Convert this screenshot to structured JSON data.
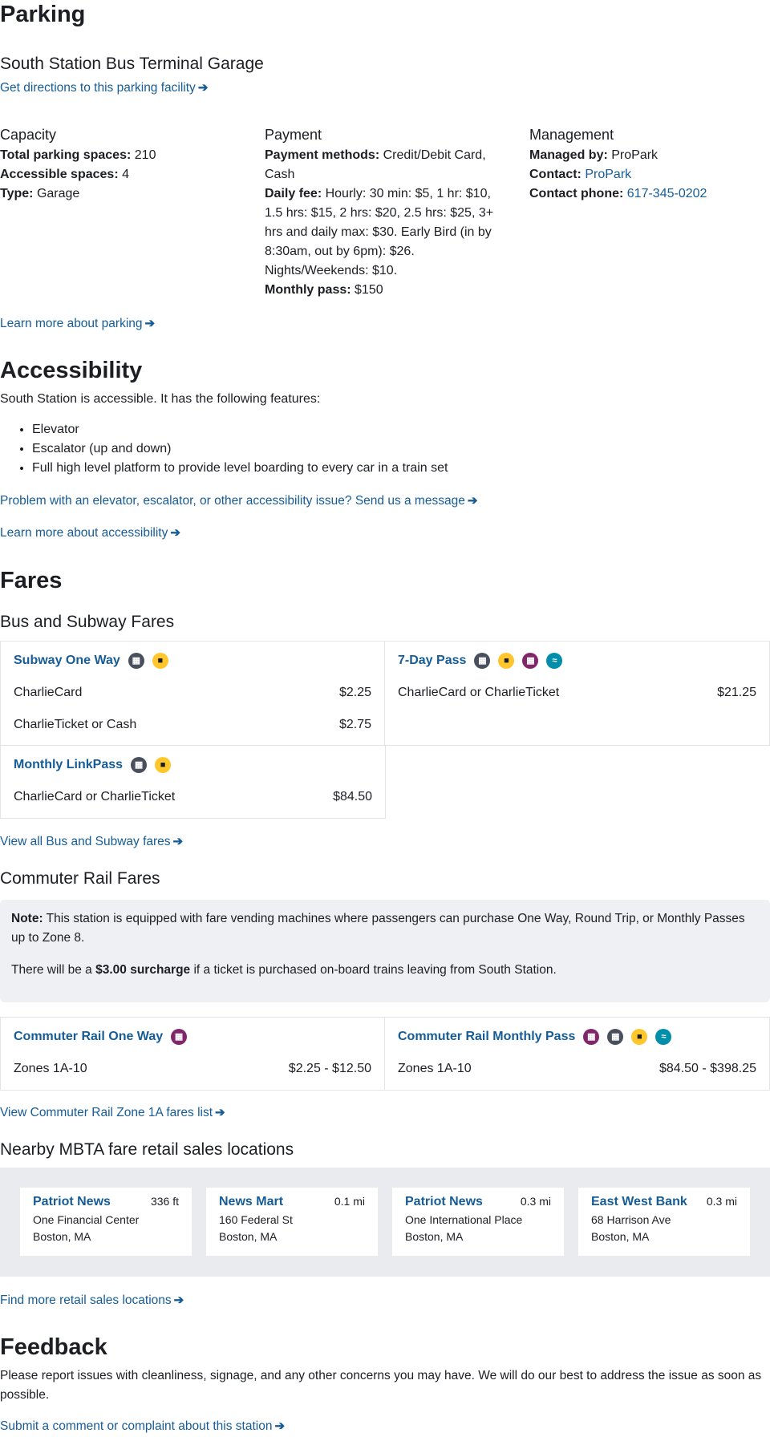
{
  "parking": {
    "title": "Parking",
    "garage_name": "South Station Bus Terminal Garage",
    "directions_link": "Get directions to this parking facility",
    "capacity": {
      "title": "Capacity",
      "total_label": "Total parking spaces:",
      "total_value": "210",
      "accessible_label": "Accessible spaces:",
      "accessible_value": "4",
      "type_label": "Type:",
      "type_value": "Garage"
    },
    "payment": {
      "title": "Payment",
      "methods_label": "Payment methods:",
      "methods_value": "Credit/Debit Card, Cash",
      "fee_label": "Daily fee:",
      "fee_value": "Hourly: 30 min: $5, 1 hr: $10, 1.5 hrs: $15, 2 hrs: $20, 2.5 hrs: $25, 3+ hrs and daily max: $30. Early Bird (in by 8:30am, out by 6pm): $26. Nights/Weekends: $10.",
      "monthly_label": "Monthly pass:",
      "monthly_value": "$150"
    },
    "management": {
      "title": "Management",
      "managed_label": "Managed by:",
      "managed_value": "ProPark",
      "contact_label": "Contact:",
      "contact_value": "ProPark",
      "phone_label": "Contact phone:",
      "phone_value": "617-345-0202"
    },
    "learn_more": "Learn more about parking"
  },
  "accessibility": {
    "title": "Accessibility",
    "intro": "South Station is accessible. It has the following features:",
    "features": [
      "Elevator",
      "Escalator (up and down)",
      "Full high level platform to provide level boarding to every car in a train set"
    ],
    "problem_link": "Problem with an elevator, escalator, or other accessibility issue? Send us a message",
    "learn_more": "Learn more about accessibility"
  },
  "fares": {
    "title": "Fares",
    "bus_subway_title": "Bus and Subway Fares",
    "cards": [
      {
        "name": "Subway One Way",
        "rows": [
          {
            "label": "CharlieCard",
            "price": "$2.25"
          },
          {
            "label": "CharlieTicket or Cash",
            "price": "$2.75"
          }
        ]
      },
      {
        "name": "7-Day Pass",
        "rows": [
          {
            "label": "CharlieCard or CharlieTicket",
            "price": "$21.25"
          }
        ]
      },
      {
        "name": "Monthly LinkPass",
        "rows": [
          {
            "label": "CharlieCard or CharlieTicket",
            "price": "$84.50"
          }
        ]
      }
    ],
    "view_all_bus": "View all Bus and Subway fares",
    "commuter_title": "Commuter Rail Fares",
    "note_label": "Note:",
    "note_text": "This station is equipped with fare vending machines where passengers can purchase One Way, Round Trip, or Monthly Passes up to Zone 8.",
    "surcharge_pre": "There will be a",
    "surcharge_bold": "$3.00 surcharge",
    "surcharge_post": "if a ticket is purchased on-board trains leaving from South Station.",
    "cr_cards": [
      {
        "name": "Commuter Rail One Way",
        "zone": "Zones 1A-10",
        "price": "$2.25 - $12.50"
      },
      {
        "name": "Commuter Rail Monthly Pass",
        "zone": "Zones 1A-10",
        "price": "$84.50 - $398.25"
      }
    ],
    "view_cr": "View Commuter Rail Zone 1A fares list",
    "retail_title": "Nearby MBTA fare retail sales locations",
    "retail": [
      {
        "name": "Patriot News",
        "dist": "336 ft",
        "addr1": "One Financial Center",
        "addr2": "Boston, MA"
      },
      {
        "name": "News Mart",
        "dist": "0.1 mi",
        "addr1": "160 Federal St",
        "addr2": "Boston, MA"
      },
      {
        "name": "Patriot News",
        "dist": "0.3 mi",
        "addr1": "One International Place",
        "addr2": "Boston, MA"
      },
      {
        "name": "East West Bank",
        "dist": "0.3 mi",
        "addr1": "68 Harrison Ave",
        "addr2": "Boston, MA"
      }
    ],
    "find_more": "Find more retail sales locations"
  },
  "feedback": {
    "title": "Feedback",
    "text": "Please report issues with cleanliness, signage, and any other concerns you may have. We will do our best to address the issue as soon as possible.",
    "link": "Submit a comment or complaint about this station"
  },
  "colors": {
    "link": "#165c96",
    "bus": "#ffc72c",
    "subway": "#494f5c",
    "commuter_rail": "#80276c",
    "ferry": "#008eaa"
  },
  "icons": [
    "arrow-right-icon",
    "subway-icon",
    "bus-icon",
    "commuter-rail-icon",
    "ferry-icon"
  ]
}
